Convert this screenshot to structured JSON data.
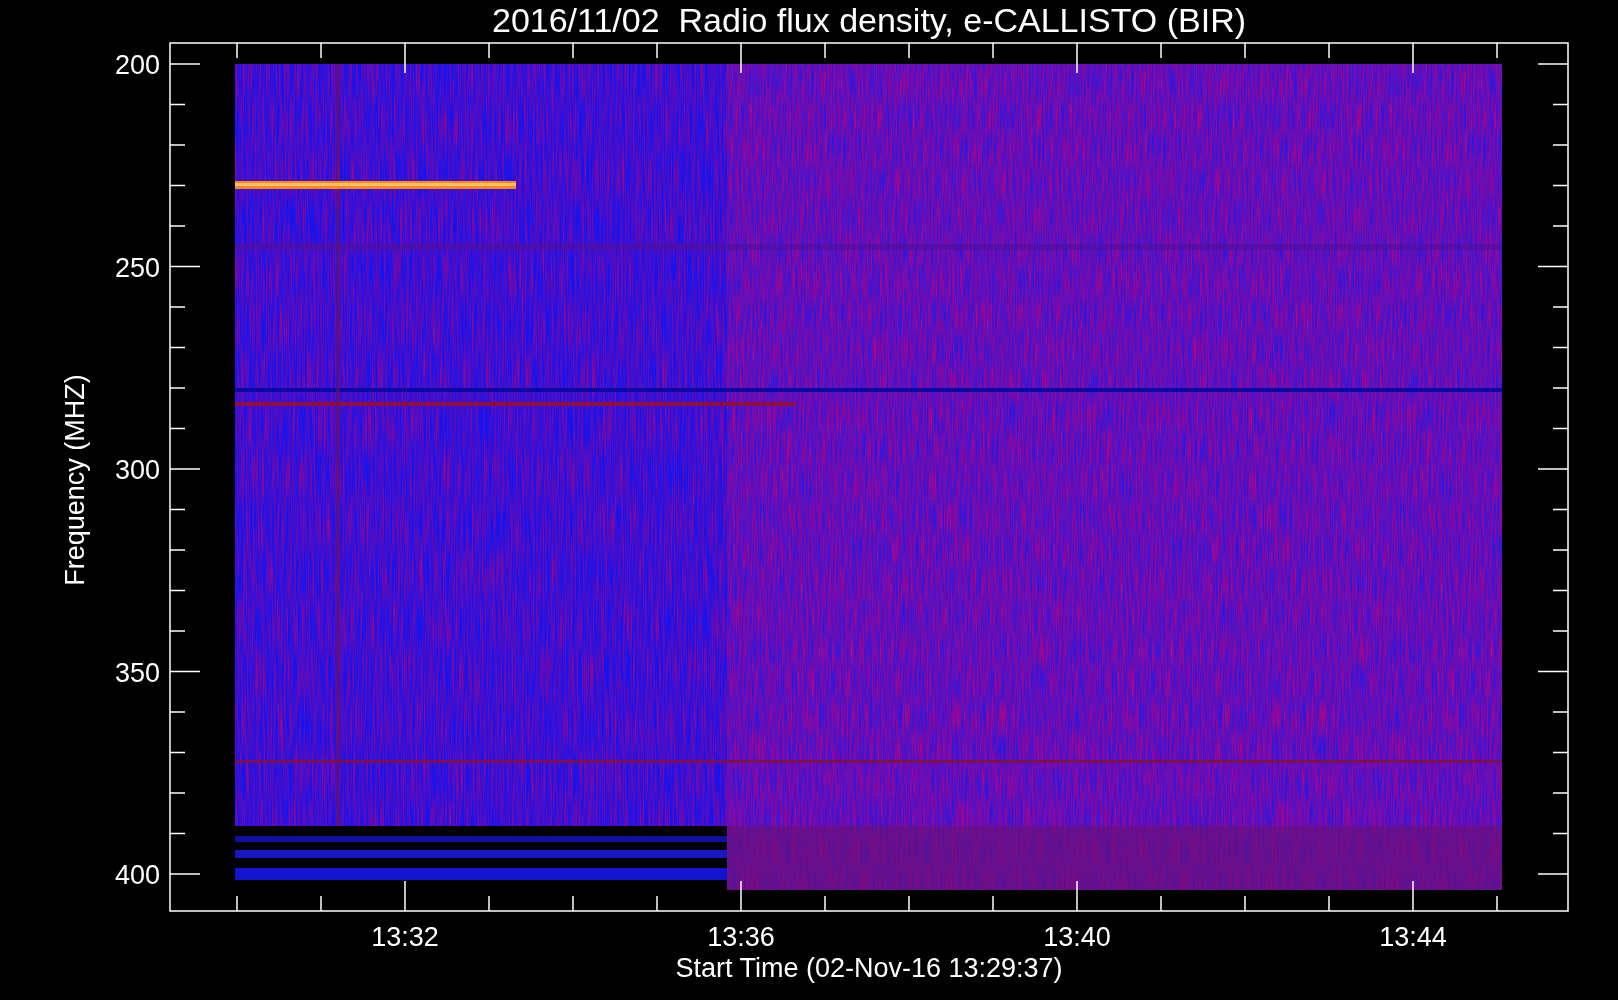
{
  "title": "2016/11/02  Radio flux density, e-CALLISTO (BIR)",
  "y_axis": {
    "label": "Frequency (MHZ)",
    "ticks": [
      "200",
      "250",
      "300",
      "350",
      "400"
    ]
  },
  "x_axis": {
    "label": "Start Time (02-Nov-16 13:29:37)",
    "ticks": [
      "13:32",
      "13:36",
      "13:40",
      "13:44"
    ]
  }
}
